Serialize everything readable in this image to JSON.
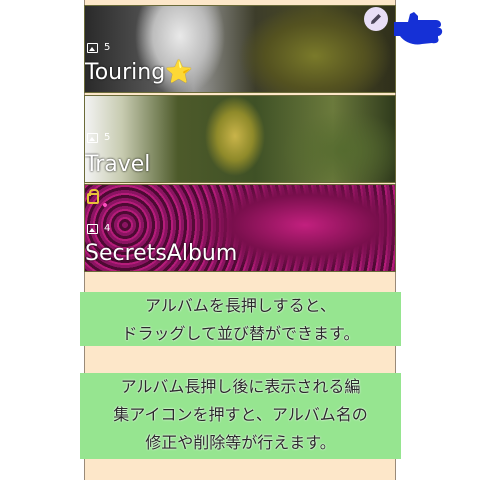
{
  "albums": [
    {
      "title": "Touring",
      "badge": "⭐",
      "count": "5",
      "locked": false
    },
    {
      "title": "Travel",
      "count": "5",
      "locked": false
    },
    {
      "title": "SecretsAlbum",
      "count": "4",
      "locked": true
    }
  ],
  "edit_button": {
    "icon": "pencil-icon"
  },
  "pointer": {
    "icon": "pointing-hand-icon",
    "color": "#1530d6"
  },
  "notes": {
    "note1": [
      "アルバムを長押しすると、",
      "ドラッグして並び替ができます。"
    ],
    "note2": [
      "アルバム長押し後に表示される編",
      "集アイコンを押すと、アルバム名の",
      "修正や削除等が行えます。"
    ]
  },
  "colors": {
    "background": "#fde7c9",
    "note_background": "#96e590",
    "lock": "#e6c23a"
  }
}
